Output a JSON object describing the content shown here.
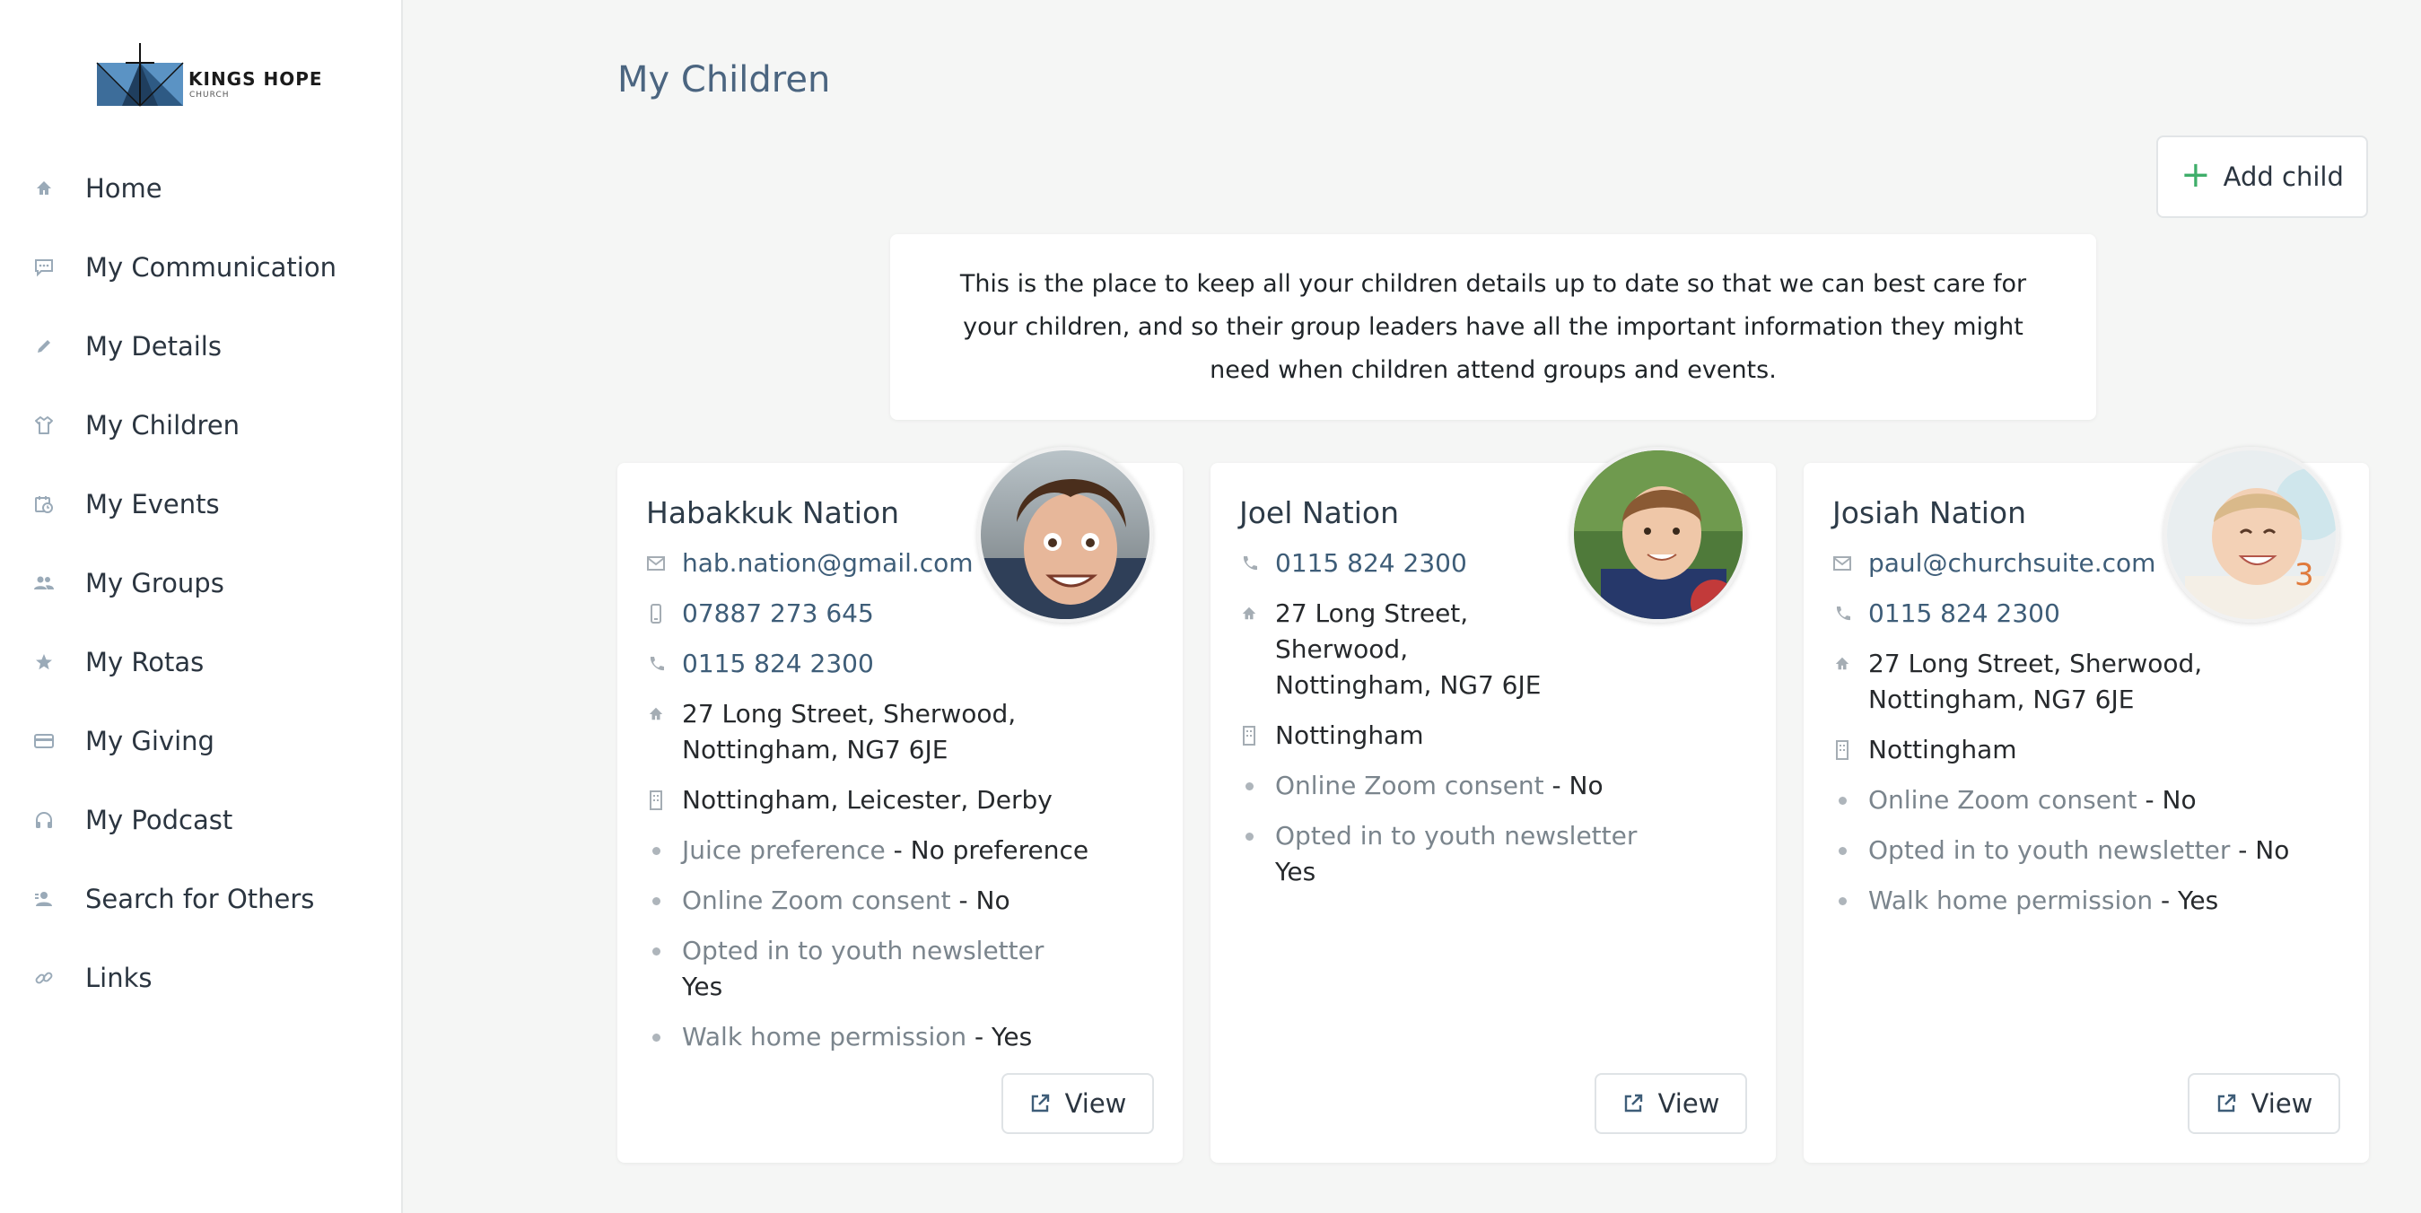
{
  "brand": {
    "name": "KINGS HOPE",
    "sub": "CHURCH"
  },
  "sidebar": {
    "items": [
      {
        "label": "Home",
        "icon": "home-icon"
      },
      {
        "label": "My Communication",
        "icon": "chat-icon"
      },
      {
        "label": "My Details",
        "icon": "pencil-icon"
      },
      {
        "label": "My Children",
        "icon": "shirt-icon"
      },
      {
        "label": "My Events",
        "icon": "calendar-icon"
      },
      {
        "label": "My Groups",
        "icon": "people-icon"
      },
      {
        "label": "My Rotas",
        "icon": "star-icon"
      },
      {
        "label": "My Giving",
        "icon": "card-icon"
      },
      {
        "label": "My Podcast",
        "icon": "headphones-icon"
      },
      {
        "label": "Search for Others",
        "icon": "person-search-icon"
      },
      {
        "label": "Links",
        "icon": "link-icon"
      }
    ]
  },
  "main": {
    "title": "My Children",
    "add_label": "Add child",
    "intro": "This is the place to keep all your children details up to date so that we can best care for your children, and so their group leaders have all the important information they might need when children attend groups and events.",
    "view_label": "View"
  },
  "children": [
    {
      "name": "Habakkuk Nation",
      "email": "hab.nation@gmail.com",
      "mobile": "07887 273 645",
      "phone": "0115 824 2300",
      "address": "27 Long Street, Sherwood, Nottingham, NG7 6JE",
      "sites": "Nottingham, Leicester, Derby",
      "fields": [
        {
          "key": "Juice preference",
          "value": " - No preference"
        },
        {
          "key": "Online Zoom consent",
          "value": " - No"
        },
        {
          "key": "Opted in to youth newsletter",
          "value": "Yes"
        },
        {
          "key": "Walk home permission",
          "value": " - Yes"
        }
      ]
    },
    {
      "name": "Joel Nation",
      "phone": "0115 824 2300",
      "address": "27 Long Street, Sherwood, Nottingham, NG7 6JE",
      "sites": "Nottingham",
      "fields": [
        {
          "key": "Online Zoom consent",
          "value": " - No"
        },
        {
          "key": "Opted in to youth newsletter",
          "value": "Yes"
        }
      ]
    },
    {
      "name": "Josiah Nation",
      "email": "paul@churchsuite.com",
      "phone": "0115 824 2300",
      "address": "27 Long Street, Sherwood, Nottingham, NG7 6JE",
      "sites": "Nottingham",
      "fields": [
        {
          "key": "Online Zoom consent",
          "value": " - No"
        },
        {
          "key": "Opted in to youth newsletter",
          "value": " - No"
        },
        {
          "key": "Walk home permission",
          "value": " - Yes"
        }
      ]
    }
  ],
  "colors": {
    "accent": "#3e5d78",
    "add_plus": "#3fae6a",
    "title": "#4b6580"
  }
}
